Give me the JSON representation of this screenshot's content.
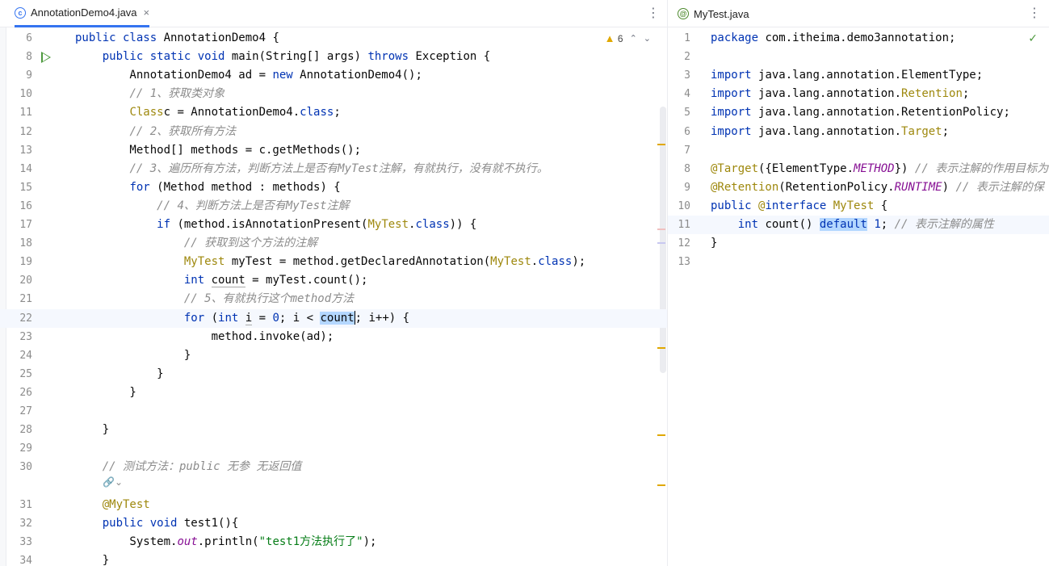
{
  "left_tab": {
    "title": "AnnotationDemo4.java",
    "icon": "class-icon",
    "close": "×"
  },
  "right_tab": {
    "title": "MyTest.java",
    "icon": "annotation-icon"
  },
  "kebab": "⋮",
  "warnings": {
    "count": "6",
    "up": "⌃",
    "down": "⌄"
  },
  "inlay_hint": "🔗⌄",
  "check": "✓",
  "left_lines": [
    {
      "n": "6",
      "t": [
        [
          "kw",
          "public class "
        ],
        [
          "",
          "AnnotationDemo4 {"
        ]
      ]
    },
    {
      "n": "8",
      "t": [
        [
          "",
          "    "
        ],
        [
          "kw",
          "public static void "
        ],
        [
          "",
          "main(String[] args) "
        ],
        [
          "kw",
          "throws "
        ],
        [
          "",
          "Exception {"
        ]
      ]
    },
    {
      "n": "9",
      "t": [
        [
          "",
          "        AnnotationDemo4 ad = "
        ],
        [
          "kw",
          "new "
        ],
        [
          "",
          "AnnotationDemo4();"
        ]
      ]
    },
    {
      "n": "10",
      "t": [
        [
          "",
          "        "
        ],
        [
          "cm",
          "// 1、获取类对象"
        ]
      ]
    },
    {
      "n": "11",
      "t": [
        [
          "",
          "        "
        ],
        [
          "ty",
          "Class"
        ],
        [
          "",
          "",
          " "
        ],
        [
          "",
          ""
        ],
        [
          "",
          "c = AnnotationDemo4."
        ],
        [
          "kw",
          "class"
        ],
        [
          "",
          ";"
        ]
      ]
    },
    {
      "n": "12",
      "t": [
        [
          "",
          "        "
        ],
        [
          "cm",
          "// 2、获取所有方法"
        ]
      ]
    },
    {
      "n": "13",
      "t": [
        [
          "",
          "        Method[] methods = c.getMethods();"
        ]
      ]
    },
    {
      "n": "14",
      "t": [
        [
          "",
          "        "
        ],
        [
          "cm",
          "// 3、遍历所有方法，判断方法上是否有MyTest注解，有就执行，没有就不执行。"
        ]
      ]
    },
    {
      "n": "15",
      "t": [
        [
          "",
          "        "
        ],
        [
          "kw",
          "for "
        ],
        [
          "",
          "(Method method : methods) {"
        ]
      ]
    },
    {
      "n": "16",
      "t": [
        [
          "",
          "            "
        ],
        [
          "cm",
          "// 4、判断方法上是否有MyTest注解"
        ]
      ]
    },
    {
      "n": "17",
      "t": [
        [
          "",
          "            "
        ],
        [
          "kw",
          "if "
        ],
        [
          "",
          "(method.isAnnotationPresent("
        ],
        [
          "ty",
          "MyTest"
        ],
        [
          "",
          "."
        ],
        [
          "kw",
          "class"
        ],
        [
          "",
          ")) {"
        ]
      ]
    },
    {
      "n": "18",
      "t": [
        [
          "",
          "                "
        ],
        [
          "cm",
          "// 获取到这个方法的注解"
        ]
      ]
    },
    {
      "n": "19",
      "t": [
        [
          "",
          "                "
        ],
        [
          "ty",
          "MyTest"
        ],
        [
          "",
          " myTest = method.getDeclaredAnnotation("
        ],
        [
          "ty",
          "MyTest"
        ],
        [
          "",
          "."
        ],
        [
          "kw",
          "class"
        ],
        [
          "",
          ");"
        ]
      ]
    },
    {
      "n": "20",
      "t": [
        [
          "",
          "                "
        ],
        [
          "kw",
          "int "
        ],
        [
          "uvar",
          "count"
        ],
        [
          "",
          " = myTest.count();"
        ]
      ]
    },
    {
      "n": "21",
      "t": [
        [
          "",
          "                "
        ],
        [
          "cm",
          "// 5、有就执行这个method方法"
        ]
      ]
    },
    {
      "n": "22",
      "t": [
        [
          "",
          "                "
        ],
        [
          "kw",
          "for "
        ],
        [
          "",
          "("
        ],
        [
          "kw",
          "int "
        ],
        [
          "uvar",
          "i"
        ],
        [
          "",
          " = "
        ],
        [
          "kw",
          "0"
        ],
        [
          "",
          "; i < "
        ],
        [
          "hl",
          "count"
        ],
        [
          "caret",
          ""
        ],
        [
          "",
          "; i++) {"
        ]
      ]
    },
    {
      "n": "23",
      "t": [
        [
          "",
          "                    method.invoke(ad);"
        ]
      ]
    },
    {
      "n": "24",
      "t": [
        [
          "",
          "                }"
        ]
      ]
    },
    {
      "n": "25",
      "t": [
        [
          "",
          "            }"
        ]
      ]
    },
    {
      "n": "26",
      "t": [
        [
          "",
          "        }"
        ]
      ]
    },
    {
      "n": "27",
      "t": []
    },
    {
      "n": "28",
      "t": [
        [
          "",
          "    }"
        ]
      ]
    },
    {
      "n": "29",
      "t": []
    },
    {
      "n": "30",
      "t": [
        [
          "",
          "    "
        ],
        [
          "cm",
          "// 测试方法：public 无参 无返回值"
        ]
      ]
    },
    {
      "n": "31",
      "t": [
        [
          "",
          "    "
        ],
        [
          "an",
          "@MyTest"
        ]
      ]
    },
    {
      "n": "32",
      "t": [
        [
          "",
          "    "
        ],
        [
          "kw",
          "public void "
        ],
        [
          "",
          "test1(){"
        ]
      ]
    },
    {
      "n": "33",
      "t": [
        [
          "",
          "        System."
        ],
        [
          "pu",
          "out"
        ],
        [
          "",
          ".println("
        ],
        [
          "st",
          "\"test1方法执行了\""
        ],
        [
          "",
          ");"
        ]
      ]
    },
    {
      "n": "34",
      "t": [
        [
          "",
          "    }"
        ]
      ]
    }
  ],
  "right_lines": [
    {
      "n": "1",
      "t": [
        [
          "kw",
          "package "
        ],
        [
          "",
          "com.itheima.demo3annotation;"
        ]
      ]
    },
    {
      "n": "2",
      "t": []
    },
    {
      "n": "3",
      "t": [
        [
          "kw",
          "import "
        ],
        [
          "",
          "java.lang.annotation.ElementType;"
        ]
      ]
    },
    {
      "n": "4",
      "t": [
        [
          "kw",
          "import "
        ],
        [
          "",
          "java.lang.annotation."
        ],
        [
          "ty",
          "Retention"
        ],
        [
          "",
          ";"
        ]
      ]
    },
    {
      "n": "5",
      "t": [
        [
          "kw",
          "import "
        ],
        [
          "",
          "java.lang.annotation.RetentionPolicy;"
        ]
      ]
    },
    {
      "n": "6",
      "t": [
        [
          "kw",
          "import "
        ],
        [
          "",
          "java.lang.annotation."
        ],
        [
          "ty",
          "Target"
        ],
        [
          "",
          ";"
        ]
      ]
    },
    {
      "n": "7",
      "t": []
    },
    {
      "n": "8",
      "t": [
        [
          "an",
          "@Target"
        ],
        [
          "",
          "({ElementType."
        ],
        [
          "pu",
          "METHOD"
        ],
        [
          "",
          "}) "
        ],
        [
          "cm",
          "// 表示注解的作用目标为"
        ]
      ]
    },
    {
      "n": "9",
      "t": [
        [
          "an",
          "@Retention"
        ],
        [
          "",
          "(RetentionPolicy."
        ],
        [
          "pu",
          "RUNTIME"
        ],
        [
          "",
          ") "
        ],
        [
          "cm",
          "// 表示注解的保"
        ]
      ]
    },
    {
      "n": "10",
      "t": [
        [
          "kw",
          "public "
        ],
        [
          "an",
          "@"
        ],
        [
          "kw",
          "interface "
        ],
        [
          "ty",
          "MyTest"
        ],
        [
          "",
          " {"
        ]
      ]
    },
    {
      "n": "11",
      "t": [
        [
          "",
          "    "
        ],
        [
          "kw",
          "int "
        ],
        [
          "",
          "count() "
        ],
        [
          "hlk",
          "default"
        ],
        [
          "",
          " "
        ],
        [
          "kw",
          "1"
        ],
        [
          "",
          "; "
        ],
        [
          "cm",
          "// 表示注解的属性"
        ]
      ]
    },
    {
      "n": "12",
      "t": [
        [
          "",
          "}"
        ]
      ]
    },
    {
      "n": "13",
      "t": []
    }
  ],
  "colors": {
    "accent": "#3574f0",
    "keyword": "#0033b3",
    "comment": "#8c8c8c",
    "annotation": "#9e880d",
    "string": "#067d17"
  }
}
